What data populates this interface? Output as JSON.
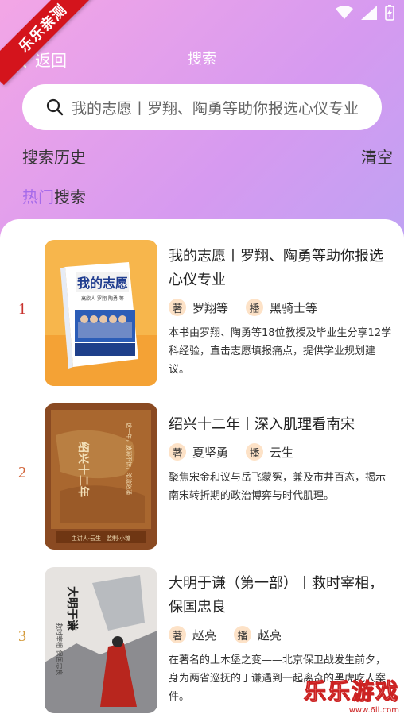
{
  "badge": "乐乐亲测",
  "header": {
    "back_label": "返回",
    "title": "搜索"
  },
  "search": {
    "placeholder": "我的志愿丨罗翔、陶勇等助你报选心仪专业"
  },
  "history": {
    "title": "搜索历史",
    "clear_label": "清空"
  },
  "hot": {
    "title_accent": "热门",
    "title_rest": "搜索"
  },
  "items": [
    {
      "rank": "1",
      "rank_color": "#c8322d",
      "title": "我的志愿丨罗翔、陶勇等助你报选心仪专业",
      "author_badge": "著",
      "author": "罗翔等",
      "narrator_badge": "播",
      "narrator": "黑骑士等",
      "description": "本书由罗翔、陶勇等18位教授及毕业生分享12学科经验，直击志愿填报痛点，提供学业规划建议。",
      "cover": {
        "title": "我的志愿",
        "author_line": "高欣人 罗翔 陶勇 等",
        "icon": "book-cover-orange"
      }
    },
    {
      "rank": "2",
      "rank_color": "#d2643a",
      "title": "绍兴十二年丨深入肌理看南宋",
      "author_badge": "著",
      "author": "夏坚勇",
      "narrator_badge": "播",
      "narrator": "云生",
      "description": "聚焦宋金和议与岳飞蒙冤，兼及市井百态，揭示南宋转折期的政治博弈与时代肌理。",
      "cover": {
        "title": "绍兴十二年",
        "side_text": "这一年，波澜不惊，暗流汹涌",
        "footer": "主讲人·云生　监制·小糖",
        "icon": "book-cover-brown"
      }
    },
    {
      "rank": "3",
      "rank_color": "#d49a3a",
      "title": "大明于谦（第一部）丨救时宰相，保国忠良",
      "author_badge": "著",
      "author": "赵亮",
      "narrator_badge": "播",
      "narrator": "赵亮",
      "description": "在著名的土木堡之变——北京保卫战发生前夕，身为两省巡抚的于谦遇到一起离奇的黑虎吃人案件。",
      "cover": {
        "title": "大明于谦",
        "side_text": "救时宰相 保国忠良",
        "icon": "book-cover-snow"
      }
    }
  ],
  "watermark": {
    "main": "乐乐游戏",
    "sub": "www.6ll.com"
  },
  "colors": {
    "accent": "#a66bea",
    "ribbon": "#d4141c"
  }
}
